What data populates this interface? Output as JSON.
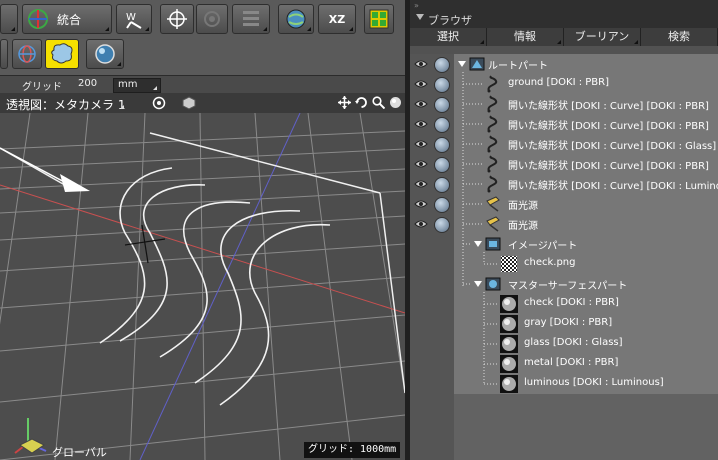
{
  "toolbar": {
    "mode_label": "統合",
    "xz_label": "XZ"
  },
  "grid_bar": {
    "label": "グリッド",
    "value": "200",
    "unit": "mm"
  },
  "view_bar": {
    "view_label": "透視図：メタカメラ 1"
  },
  "viewport": {
    "coord_label": "グローバル",
    "grid_status": "グリッド: 1000mm"
  },
  "browser": {
    "title": "ブラウザ",
    "tabs": [
      {
        "label": "選択"
      },
      {
        "label": "情報"
      },
      {
        "label": "ブーリアン"
      },
      {
        "label": "検索"
      }
    ],
    "rows": [
      {
        "label": "ルートパート",
        "icon": "part-icon"
      },
      {
        "label": "ground [DOKI : PBR]",
        "icon": "curve-icon"
      },
      {
        "label": "開いた線形状 [DOKI : Curve] [DOKI : PBR]",
        "icon": "curve-icon"
      },
      {
        "label": "開いた線形状 [DOKI : Curve] [DOKI : PBR]",
        "icon": "curve-icon"
      },
      {
        "label": "開いた線形状 [DOKI : Curve] [DOKI : Glass]",
        "icon": "curve-icon"
      },
      {
        "label": "開いた線形状 [DOKI : Curve] [DOKI : PBR]",
        "icon": "curve-icon"
      },
      {
        "label": "開いた線形状 [DOKI : Curve] [DOKI : Luminous]",
        "icon": "curve-icon"
      },
      {
        "label": "面光源",
        "icon": "area-light-icon"
      },
      {
        "label": "面光源",
        "icon": "area-light-icon"
      },
      {
        "label": "イメージパート",
        "icon": "image-part-icon"
      },
      {
        "label": "check.png",
        "icon": "checker-image-icon"
      },
      {
        "label": "マスターサーフェスパート",
        "icon": "master-surface-part-icon"
      },
      {
        "label": "check [DOKI : PBR]",
        "icon": "material-sphere-icon"
      },
      {
        "label": "gray [DOKI : PBR]",
        "icon": "material-sphere-icon"
      },
      {
        "label": "glass [DOKI : Glass]",
        "icon": "material-sphere-icon"
      },
      {
        "label": "metal [DOKI : PBR]",
        "icon": "material-sphere-icon"
      },
      {
        "label": "luminous [DOKI : Luminous]",
        "icon": "material-sphere-icon"
      }
    ]
  }
}
